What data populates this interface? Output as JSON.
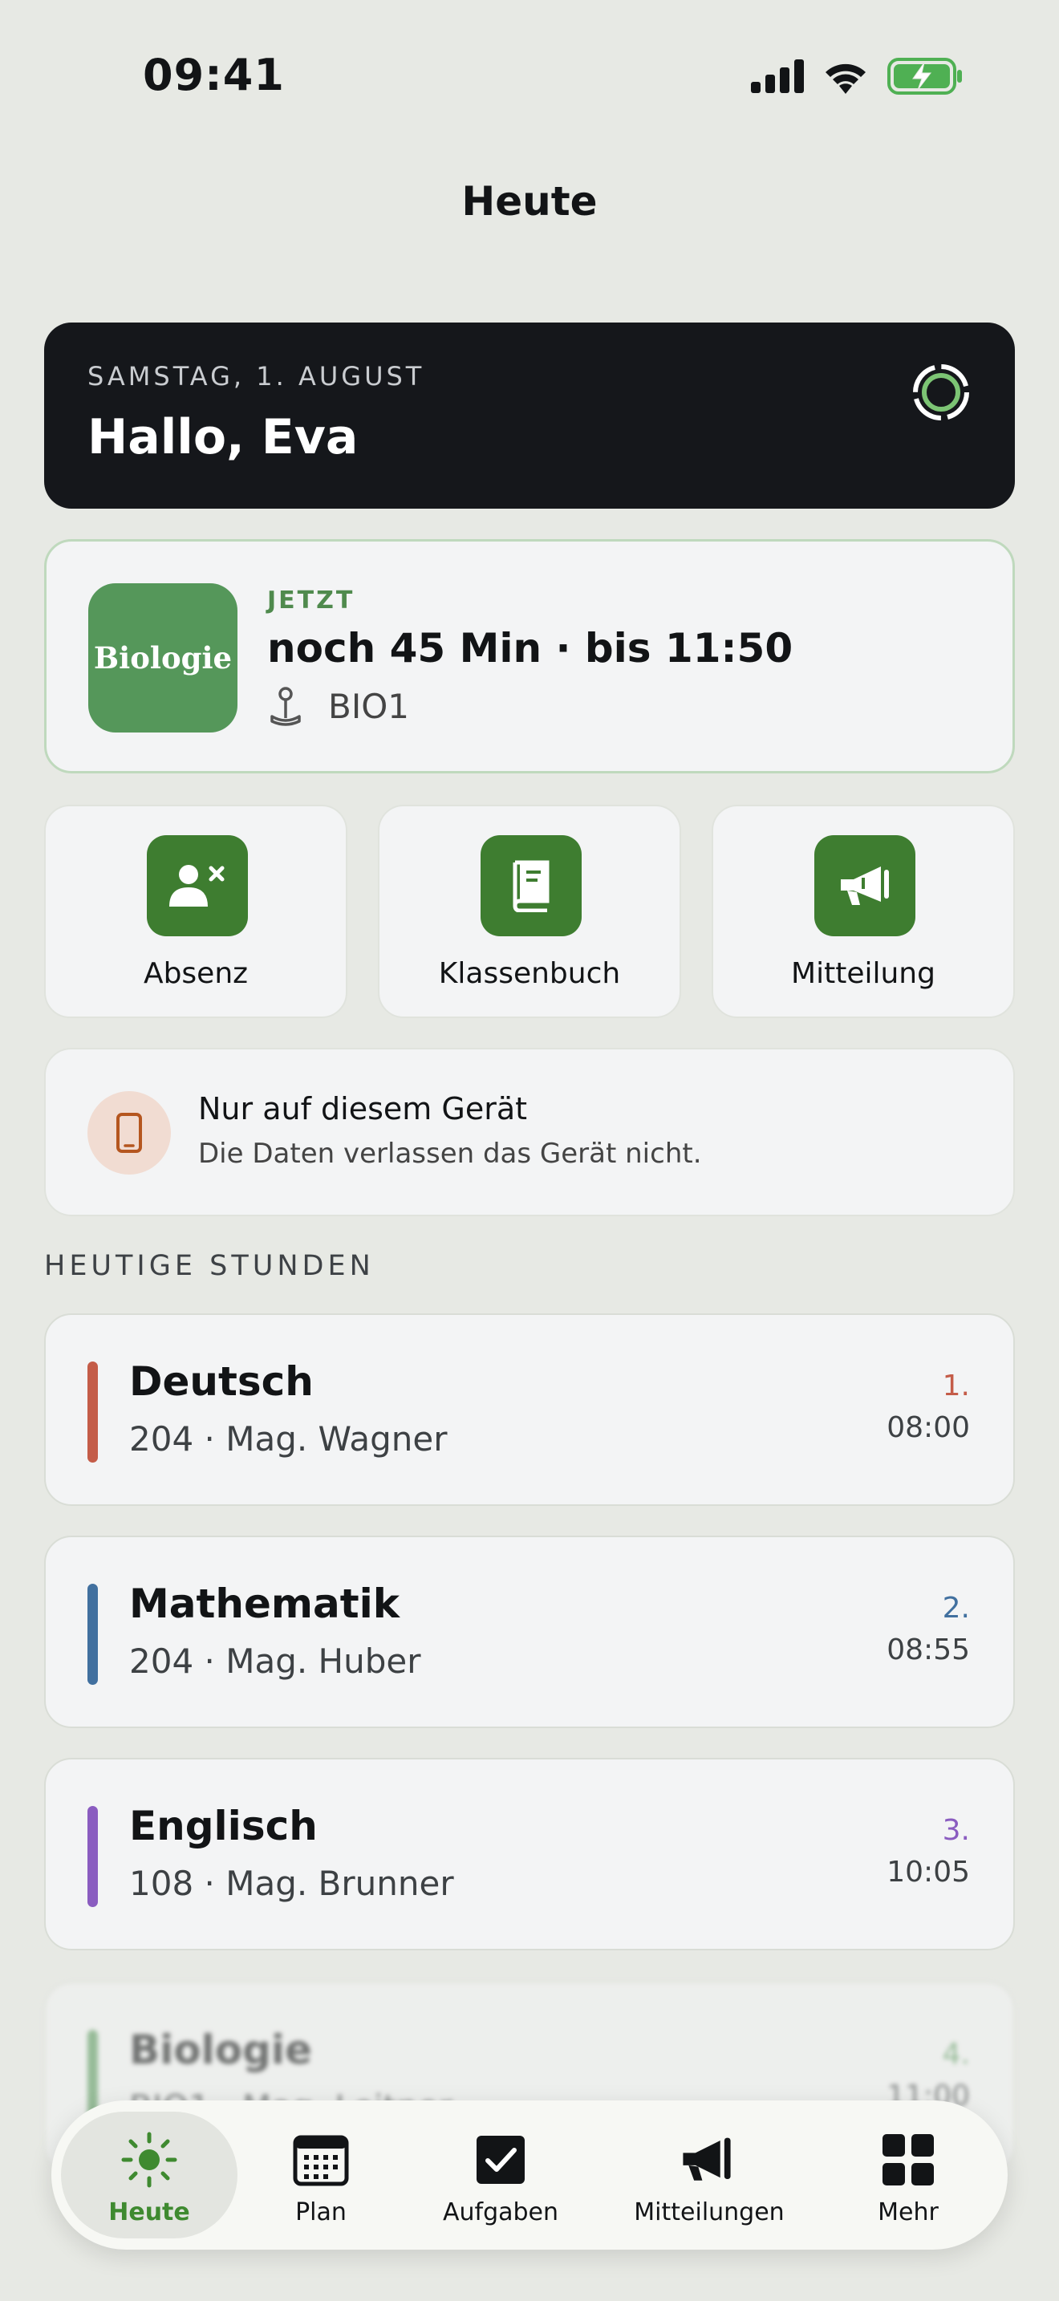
{
  "status_bar": {
    "time": "09:41"
  },
  "header": {
    "title": "Heute"
  },
  "greeting": {
    "date": "SAMSTAG, 1. AUGUST",
    "text": "Hallo, Eva"
  },
  "current_lesson": {
    "subject": "Biologie",
    "label": "JETZT",
    "time_text": "noch 45 Min · bis 11:50",
    "room": "BIO1"
  },
  "actions": [
    {
      "label": "Absenz",
      "icon": "person-remove-icon"
    },
    {
      "label": "Klassenbuch",
      "icon": "book-icon"
    },
    {
      "label": "Mitteilung",
      "icon": "megaphone-icon"
    }
  ],
  "device_notice": {
    "title": "Nur auf diesem Gerät",
    "subtitle": "Die Daten verlassen das Gerät nicht."
  },
  "section_title": "HEUTIGE STUNDEN",
  "lessons": [
    {
      "name": "Deutsch",
      "meta": "204 · Mag. Wagner",
      "number": "1.",
      "start": "08:00",
      "color": "#c45c48"
    },
    {
      "name": "Mathematik",
      "meta": "204 · Mag. Huber",
      "number": "2.",
      "start": "08:55",
      "color": "#41709f"
    },
    {
      "name": "Englisch",
      "meta": "108 · Mag. Brunner",
      "number": "3.",
      "start": "10:05",
      "color": "#8a5cc0"
    },
    {
      "name": "Biologie",
      "meta": "BIO1 · Mag. Leitner",
      "number": "4.",
      "start": "11:00",
      "color": "#55975a"
    }
  ],
  "tabs": [
    {
      "label": "Heute",
      "icon": "sun-icon",
      "active": true
    },
    {
      "label": "Plan",
      "icon": "calendar-icon"
    },
    {
      "label": "Aufgaben",
      "icon": "checkbox-icon"
    },
    {
      "label": "Mitteilungen",
      "icon": "megaphone-icon"
    },
    {
      "label": "Mehr",
      "icon": "grid-icon"
    }
  ]
}
